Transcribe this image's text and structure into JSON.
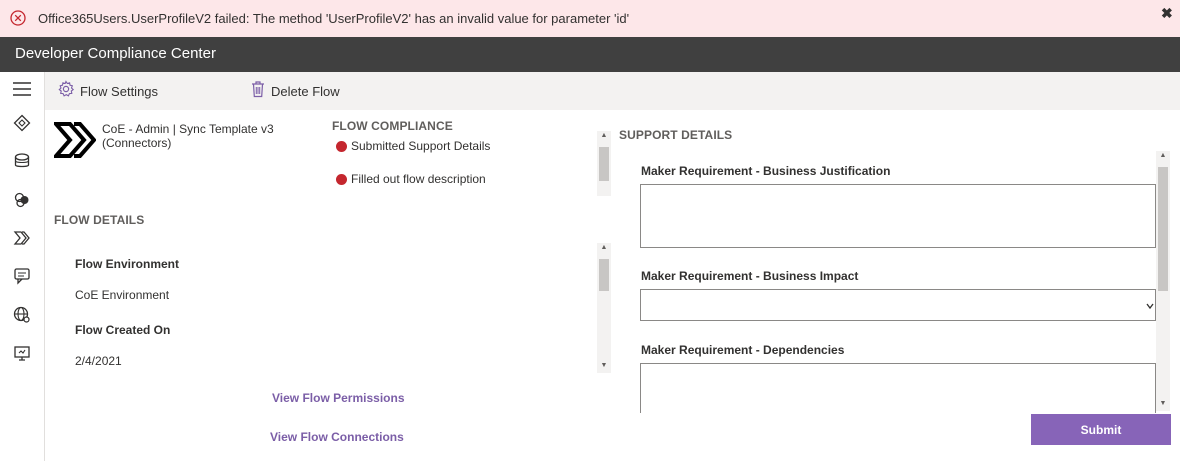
{
  "error": {
    "message": "Office365Users.UserProfileV2 failed: The method 'UserProfileV2' has an invalid value for parameter 'id'",
    "close_glyph": "✖"
  },
  "header": {
    "title": "Developer Compliance Center"
  },
  "rail": {
    "items": [
      "menu-icon",
      "environments-icon",
      "database-icon",
      "apps-icon",
      "flows-icon",
      "chat-bots-icon",
      "web-icon",
      "desktop-flows-icon"
    ]
  },
  "toolbar": {
    "flow_settings_label": "Flow Settings",
    "delete_flow_label": "Delete Flow"
  },
  "flow": {
    "name": "CoE - Admin | Sync Template v3 (Connectors)"
  },
  "compliance": {
    "title": "FLOW COMPLIANCE",
    "items": [
      {
        "label": "Submitted Support Details",
        "status_color": "#c4262e"
      },
      {
        "label": "Filled out flow description",
        "status_color": "#c4262e"
      }
    ]
  },
  "details": {
    "title": "FLOW DETAILS",
    "environment_label": "Flow Environment",
    "environment_value": "CoE Environment",
    "created_label": "Flow Created On",
    "created_value": "2/4/2021"
  },
  "links": {
    "permissions": "View Flow Permissions",
    "connections": "View Flow Connections"
  },
  "support": {
    "title": "SUPPORT DETAILS",
    "justification_label": "Maker Requirement - Business Justification",
    "impact_label": "Maker Requirement - Business Impact",
    "dependencies_label": "Maker Requirement - Dependencies",
    "submit_label": "Submit"
  },
  "colors": {
    "header_bg": "#404040",
    "error_bg": "#fde7e9",
    "accent": "#8764b8",
    "link": "#7b5ea7",
    "status_red": "#c4262e"
  }
}
